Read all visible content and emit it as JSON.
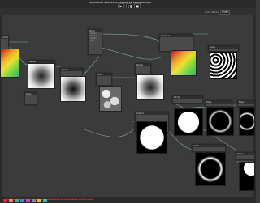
{
  "window": {
    "title": "▪▪ ▪▪▪▪▪▪ ▪▪▪▪▪▪▪▪ ▪▪▪▪▪▪ ▪▪ ▪▪▪▪▪▪▪▪▪▪▪"
  },
  "playback": {
    "play": "▶",
    "pause": "❚❚",
    "stop": "■"
  },
  "toolbar": {
    "color_mode_label": "Color Mode",
    "color_mode_value": "RGBA"
  },
  "nodes": [
    {
      "id": "gradient-1",
      "title": "Gradient"
    },
    {
      "id": "radial-1",
      "title": "Radial"
    },
    {
      "id": "radial-2",
      "title": "Radial"
    },
    {
      "id": "mixer",
      "title": "Mixer",
      "rows": [
        "Input 1",
        "Input 2",
        "Input 3",
        "Out"
      ]
    },
    {
      "id": "blobs",
      "title": "Blob"
    },
    {
      "id": "radial-3",
      "title": "Radial"
    },
    {
      "id": "gradient-2",
      "title": "Gradient"
    },
    {
      "id": "noise",
      "title": "Noise"
    },
    {
      "id": "node-a",
      "title": "Node"
    },
    {
      "id": "black-out",
      "title": "Output"
    },
    {
      "id": "ring-1",
      "title": "Edge"
    },
    {
      "id": "ring-2",
      "title": "Edge"
    },
    {
      "id": "circle-1",
      "title": "Circle"
    },
    {
      "id": "circle-2",
      "title": "Circle"
    },
    {
      "id": "partial",
      "title": "Shape"
    }
  ],
  "statusbar": {
    "message": "▪▪▪▪▪ ▪▪ ▪▪▪▪▪ ▪▪▪▪▪▪▪▪▪▪▪▪ ▪▪ ▪▪▪▪ ▪▪▪▪▪▪▪ ▪▪ ▪▪▪▪▪▪▪▪▪▪ ▪▪▪▪▪▪ ▪▪▪▪"
  },
  "colors": {
    "background": "#3b3b3b",
    "node": "#4a4a4a",
    "wire": "#7fa8a0",
    "error": "#c0392b"
  }
}
